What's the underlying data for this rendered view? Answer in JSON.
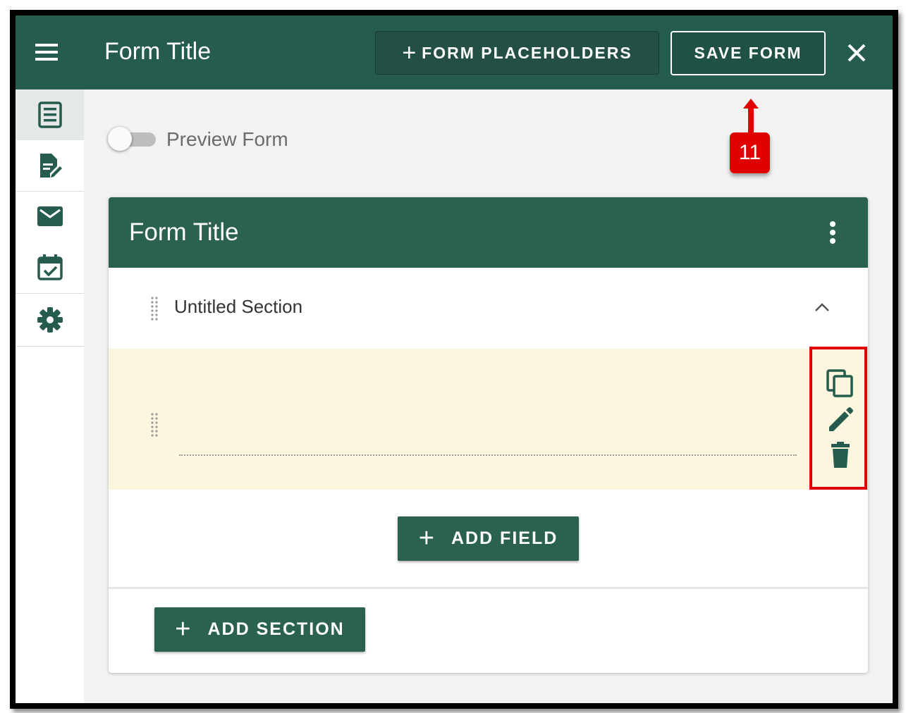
{
  "header": {
    "title": "Form Title",
    "placeholders_button": {
      "icon": "+",
      "label": "FORM PLACEHOLDERS"
    },
    "save_button": "SAVE FORM",
    "icons": {
      "menu": "menu-icon",
      "close": "close-icon"
    }
  },
  "sidebar": {
    "items": [
      {
        "icon": "form-list-icon",
        "active": true
      },
      {
        "icon": "edit-document-icon",
        "active": false
      },
      {
        "icon": "mail-icon",
        "active": false
      },
      {
        "icon": "calendar-check-icon",
        "active": false
      },
      {
        "icon": "gear-icon",
        "active": false
      }
    ]
  },
  "preview": {
    "label": "Preview Form",
    "enabled": false
  },
  "annotation": {
    "badge": "11"
  },
  "form_card": {
    "title": "Form Title",
    "section_title": "Untitled Section",
    "add_field": {
      "icon": "+",
      "label": "ADD FIELD"
    },
    "add_section": {
      "icon": "+",
      "label": "ADD SECTION"
    },
    "field_actions": [
      "copy-icon",
      "pencil-icon",
      "trash-icon"
    ]
  },
  "colors": {
    "header": "#265c4f",
    "card_header": "#2b6150",
    "field_highlight": "#fdf6df",
    "annotation_red": "#e10000"
  }
}
